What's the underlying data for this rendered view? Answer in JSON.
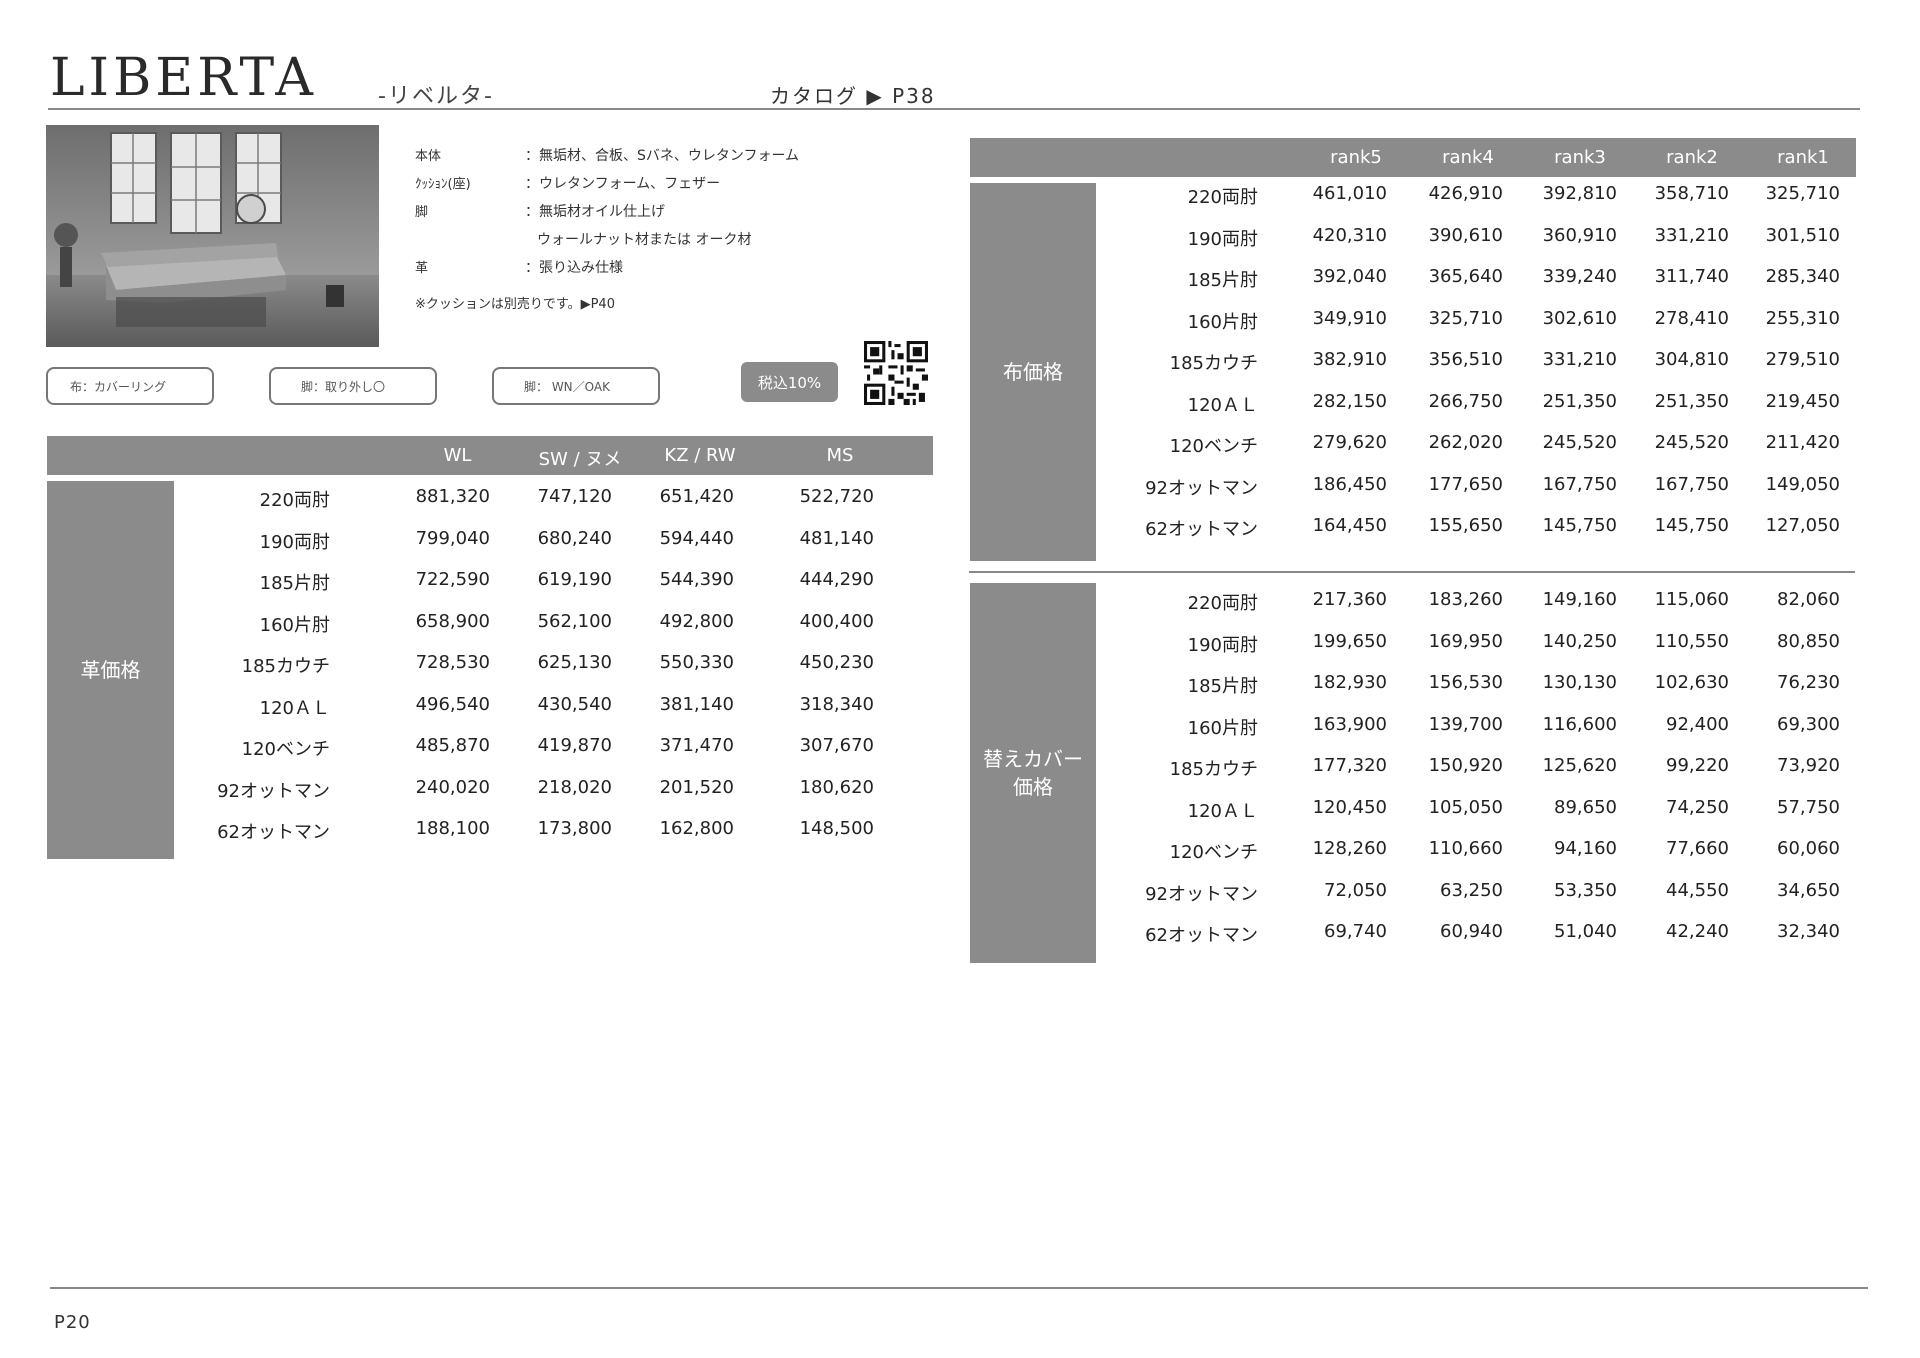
{
  "header": {
    "title": "LIBERTA",
    "subtitle": "-リベルタ-",
    "catalog": "カタログ ▶ P38"
  },
  "specs": [
    {
      "label": "本体",
      "value": "：無垢材、合板、Sバネ、ウレタンフォーム"
    },
    {
      "label": "ｸｯｼｮﾝ(座)",
      "value": "：ウレタンフォーム、フェザー"
    },
    {
      "label": "脚",
      "value": "：無垢材オイル仕上げ"
    },
    {
      "label": "",
      "value": "ウォールナット材または オーク材"
    },
    {
      "label": "革",
      "value": "：張り込み仕様"
    }
  ],
  "note": "※クッションは別売りです。▶P40",
  "options": [
    "布：カバーリング",
    "脚：取り外し〇",
    "脚： WN／OAK"
  ],
  "tax_badge": "税込10%",
  "leather_table": {
    "side_label": "革価格",
    "columns": [
      "WL",
      "SW / ヌメ",
      "KZ / RW",
      "MS"
    ],
    "rows": [
      {
        "name": "220両肘",
        "values": [
          "881,320",
          "747,120",
          "651,420",
          "522,720"
        ]
      },
      {
        "name": "190両肘",
        "values": [
          "799,040",
          "680,240",
          "594,440",
          "481,140"
        ]
      },
      {
        "name": "185片肘",
        "values": [
          "722,590",
          "619,190",
          "544,390",
          "444,290"
        ]
      },
      {
        "name": "160片肘",
        "values": [
          "658,900",
          "562,100",
          "492,800",
          "400,400"
        ]
      },
      {
        "name": "185カウチ",
        "values": [
          "728,530",
          "625,130",
          "550,330",
          "450,230"
        ]
      },
      {
        "name": "120ＡＬ",
        "values": [
          "496,540",
          "430,540",
          "381,140",
          "318,340"
        ]
      },
      {
        "name": "120ベンチ",
        "values": [
          "485,870",
          "419,870",
          "371,470",
          "307,670"
        ]
      },
      {
        "name": "92オットマン",
        "values": [
          "240,020",
          "218,020",
          "201,520",
          "180,620"
        ]
      },
      {
        "name": "62オットマン",
        "values": [
          "188,100",
          "173,800",
          "162,800",
          "148,500"
        ]
      }
    ]
  },
  "rank_columns": [
    "rank5",
    "rank4",
    "rank3",
    "rank2",
    "rank1"
  ],
  "fabric_table": {
    "side_label": "布価格",
    "rows": [
      {
        "name": "220両肘",
        "values": [
          "461,010",
          "426,910",
          "392,810",
          "358,710",
          "325,710"
        ]
      },
      {
        "name": "190両肘",
        "values": [
          "420,310",
          "390,610",
          "360,910",
          "331,210",
          "301,510"
        ]
      },
      {
        "name": "185片肘",
        "values": [
          "392,040",
          "365,640",
          "339,240",
          "311,740",
          "285,340"
        ]
      },
      {
        "name": "160片肘",
        "values": [
          "349,910",
          "325,710",
          "302,610",
          "278,410",
          "255,310"
        ]
      },
      {
        "name": "185カウチ",
        "values": [
          "382,910",
          "356,510",
          "331,210",
          "304,810",
          "279,510"
        ]
      },
      {
        "name": "120ＡＬ",
        "values": [
          "282,150",
          "266,750",
          "251,350",
          "251,350",
          "219,450"
        ]
      },
      {
        "name": "120ベンチ",
        "values": [
          "279,620",
          "262,020",
          "245,520",
          "245,520",
          "211,420"
        ]
      },
      {
        "name": "92オットマン",
        "values": [
          "186,450",
          "177,650",
          "167,750",
          "167,750",
          "149,050"
        ]
      },
      {
        "name": "62オットマン",
        "values": [
          "164,450",
          "155,650",
          "145,750",
          "145,750",
          "127,050"
        ]
      }
    ]
  },
  "cover_table": {
    "side_label_line1": "替えカバー",
    "side_label_line2": "価格",
    "rows": [
      {
        "name": "220両肘",
        "values": [
          "217,360",
          "183,260",
          "149,160",
          "115,060",
          "82,060"
        ]
      },
      {
        "name": "190両肘",
        "values": [
          "199,650",
          "169,950",
          "140,250",
          "110,550",
          "80,850"
        ]
      },
      {
        "name": "185片肘",
        "values": [
          "182,930",
          "156,530",
          "130,130",
          "102,630",
          "76,230"
        ]
      },
      {
        "name": "160片肘",
        "values": [
          "163,900",
          "139,700",
          "116,600",
          "92,400",
          "69,300"
        ]
      },
      {
        "name": "185カウチ",
        "values": [
          "177,320",
          "150,920",
          "125,620",
          "99,220",
          "73,920"
        ]
      },
      {
        "name": "120ＡＬ",
        "values": [
          "120,450",
          "105,050",
          "89,650",
          "74,250",
          "57,750"
        ]
      },
      {
        "name": "120ベンチ",
        "values": [
          "128,260",
          "110,660",
          "94,160",
          "77,660",
          "60,060"
        ]
      },
      {
        "name": "92オットマン",
        "values": [
          "72,050",
          "63,250",
          "53,350",
          "44,550",
          "34,650"
        ]
      },
      {
        "name": "62オットマン",
        "values": [
          "69,740",
          "60,940",
          "51,040",
          "42,240",
          "32,340"
        ]
      }
    ]
  },
  "footer": {
    "page": "P20"
  }
}
